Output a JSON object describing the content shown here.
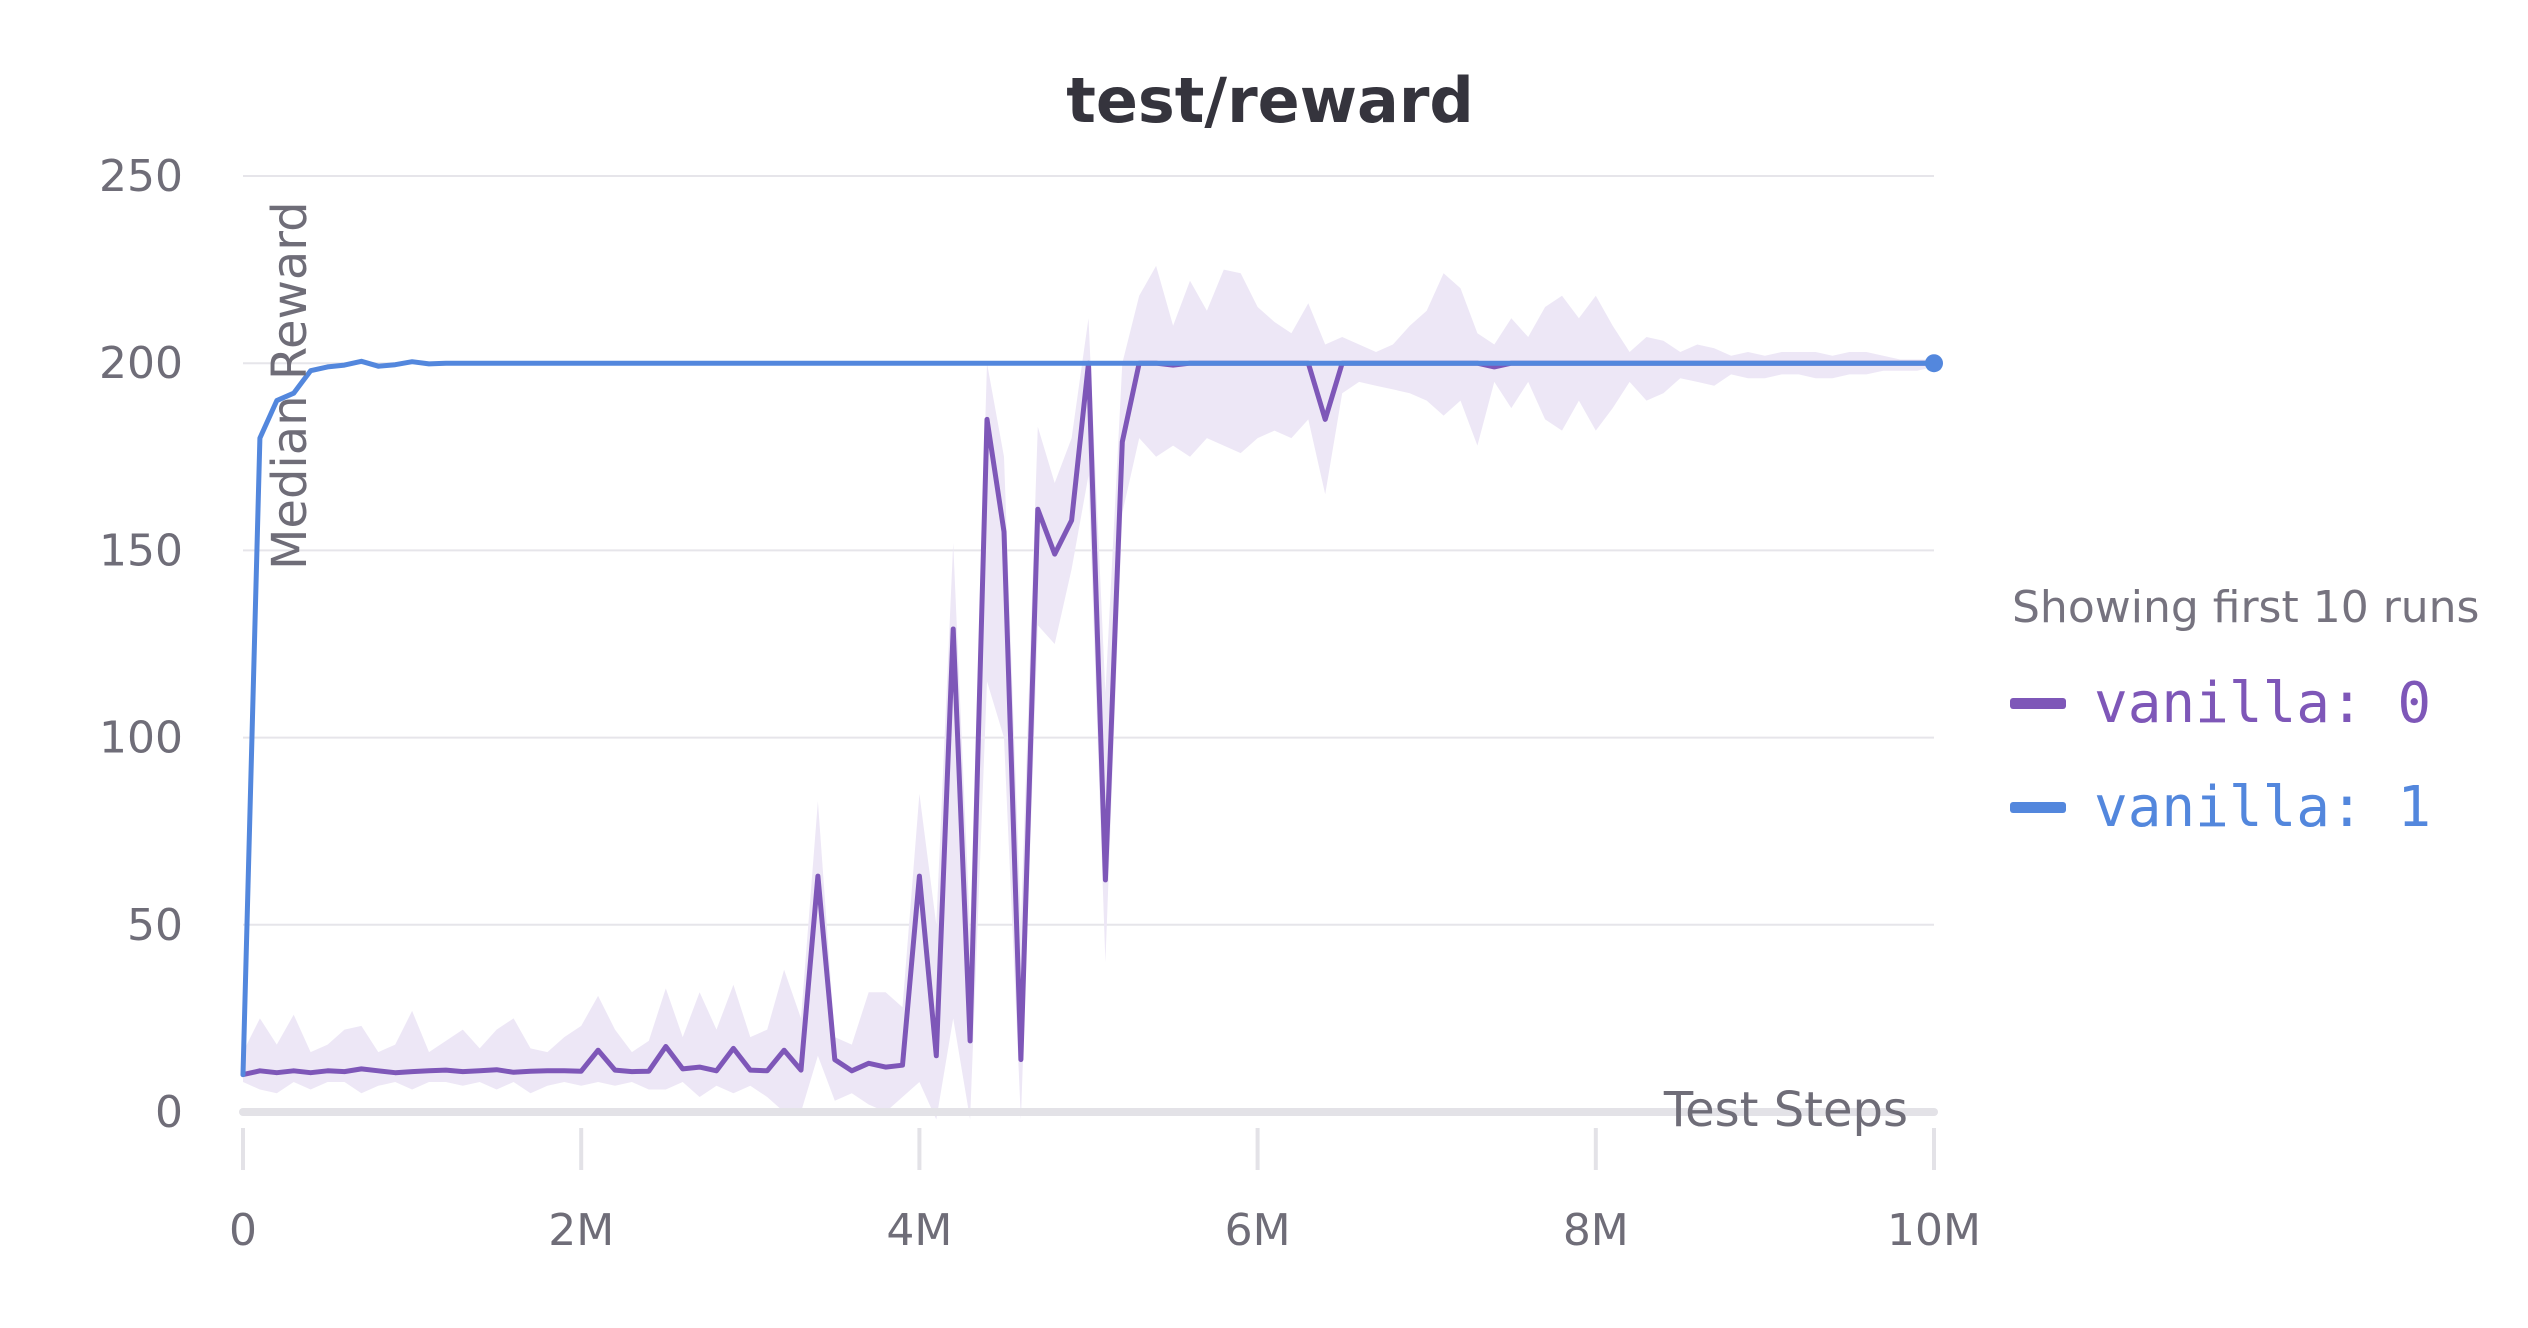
{
  "chart_data": {
    "type": "line",
    "title": "test/reward",
    "xlabel": "Test Steps",
    "ylabel": "Median Reward",
    "xlim": [
      0,
      10000000
    ],
    "ylim": [
      0,
      250
    ],
    "x_ticks": [
      {
        "value": 0,
        "label": "0"
      },
      {
        "value": 2000000,
        "label": "2M"
      },
      {
        "value": 4000000,
        "label": "4M"
      },
      {
        "value": 6000000,
        "label": "6M"
      },
      {
        "value": 8000000,
        "label": "8M"
      },
      {
        "value": 10000000,
        "label": "10M"
      }
    ],
    "y_ticks": [
      {
        "value": 0,
        "label": "0"
      },
      {
        "value": 50,
        "label": "50"
      },
      {
        "value": 100,
        "label": "100"
      },
      {
        "value": 150,
        "label": "150"
      },
      {
        "value": 200,
        "label": "200"
      },
      {
        "value": 250,
        "label": "250"
      }
    ],
    "grid": true,
    "legend_position": "right",
    "legend_caption": "Showing first 10 runs",
    "series": [
      {
        "name": "vanilla: 0",
        "color": "#7e57b8",
        "band_color": "#ede7f6",
        "x": [
          0,
          100000,
          200000,
          300000,
          400000,
          500000,
          600000,
          700000,
          800000,
          900000,
          1000000,
          1100000,
          1200000,
          1300000,
          1400000,
          1500000,
          1600000,
          1700000,
          1800000,
          1900000,
          2000000,
          2100000,
          2200000,
          2300000,
          2400000,
          2500000,
          2600000,
          2700000,
          2800000,
          2900000,
          3000000,
          3100000,
          3200000,
          3300000,
          3400000,
          3500000,
          3600000,
          3700000,
          3800000,
          3900000,
          4000000,
          4100000,
          4200000,
          4300000,
          4400000,
          4500000,
          4600000,
          4700000,
          4800000,
          4900000,
          5000000,
          5100000,
          5200000,
          5300000,
          5400000,
          5500000,
          5600000,
          5700000,
          5800000,
          5900000,
          6000000,
          6100000,
          6200000,
          6300000,
          6400000,
          6500000,
          6600000,
          6700000,
          6800000,
          6900000,
          7000000,
          7100000,
          7200000,
          7300000,
          7400000,
          7500000,
          7600000,
          7700000,
          7800000,
          7900000,
          8000000,
          8100000,
          8200000,
          8300000,
          8400000,
          8500000,
          8600000,
          8700000,
          8800000,
          8900000,
          9000000,
          9100000,
          9200000,
          9300000,
          9400000,
          9500000,
          9600000,
          9700000,
          9800000,
          9900000,
          10000000
        ],
        "values": [
          10,
          11,
          10.5,
          11,
          10.5,
          11,
          10.8,
          11.5,
          11,
          10.5,
          10.8,
          11,
          11.2,
          10.8,
          11,
          11.3,
          10.6,
          10.9,
          11,
          11,
          10.9,
          16.5,
          11.2,
          10.8,
          10.9,
          17.5,
          11.5,
          12,
          11,
          17,
          11.2,
          11,
          16.5,
          11.2,
          63,
          14,
          11,
          13,
          12,
          12.5,
          63,
          15,
          129,
          19,
          185,
          155,
          14,
          161,
          149,
          158,
          200,
          62,
          179,
          200,
          200,
          199.5,
          200,
          200,
          200,
          200,
          200,
          200,
          200,
          200,
          185,
          200,
          200,
          200,
          200,
          200,
          200,
          200,
          200,
          200,
          199,
          200,
          200,
          200,
          200,
          200,
          200,
          200,
          200,
          200,
          200,
          200,
          200,
          200,
          200,
          200,
          200,
          200,
          200,
          200,
          200,
          200,
          200,
          200,
          200,
          200,
          200
        ],
        "band_low": [
          8,
          6,
          5,
          8,
          6,
          8,
          8,
          5,
          7,
          8,
          6,
          8,
          8,
          7,
          8,
          6,
          8,
          5,
          7,
          8,
          7,
          8,
          7,
          8,
          6,
          6,
          8,
          4,
          7,
          5,
          7,
          4,
          0,
          0,
          15,
          3,
          5,
          2,
          0,
          4,
          8,
          -2,
          25,
          -2,
          115,
          100,
          -2,
          130,
          125,
          145,
          170,
          40,
          160,
          180,
          175,
          178,
          175,
          180,
          178,
          176,
          180,
          182,
          180,
          185,
          165,
          192,
          195,
          194,
          193,
          192,
          190,
          186,
          190,
          178,
          195,
          188,
          195,
          185,
          182,
          190,
          182,
          188,
          195,
          190,
          192,
          196,
          195,
          194,
          197,
          196,
          196,
          197,
          197,
          196,
          196,
          197,
          197,
          198,
          198,
          198,
          199
        ],
        "band_high": [
          16,
          25,
          18,
          26,
          16,
          18,
          22,
          23,
          16,
          18,
          27,
          16,
          19,
          22,
          17,
          22,
          25,
          17,
          16,
          20,
          23,
          31,
          22,
          16,
          19,
          33,
          20,
          32,
          22,
          34,
          20,
          22,
          38,
          25,
          83,
          20,
          18,
          32,
          32,
          28,
          85,
          50,
          152,
          48,
          200,
          175,
          50,
          183,
          168,
          180,
          212,
          112,
          200,
          218,
          226,
          210,
          222,
          214,
          225,
          224,
          215,
          211,
          208,
          216,
          205,
          207,
          205,
          203,
          205,
          210,
          214,
          224,
          220,
          208,
          205,
          212,
          207,
          215,
          218,
          212,
          218,
          210,
          203,
          207,
          206,
          203,
          205,
          204,
          202,
          203,
          202,
          203,
          203,
          203,
          202,
          203,
          203,
          202,
          201,
          201,
          201
        ]
      },
      {
        "name": "vanilla: 1",
        "color": "#5387dd",
        "x": [
          0,
          100000,
          200000,
          300000,
          400000,
          500000,
          600000,
          700000,
          800000,
          900000,
          1000000,
          1100000,
          1200000,
          1300000,
          1400000,
          1500000,
          2000000,
          3000000,
          4000000,
          5000000,
          6000000,
          7000000,
          8000000,
          9000000,
          10000000
        ],
        "values": [
          10,
          180,
          190,
          192,
          198,
          199,
          199.5,
          200.5,
          199.2,
          199.6,
          200.4,
          199.8,
          200,
          200,
          200,
          200,
          200,
          200,
          200,
          200,
          200,
          200,
          200,
          200,
          200
        ]
      }
    ]
  }
}
